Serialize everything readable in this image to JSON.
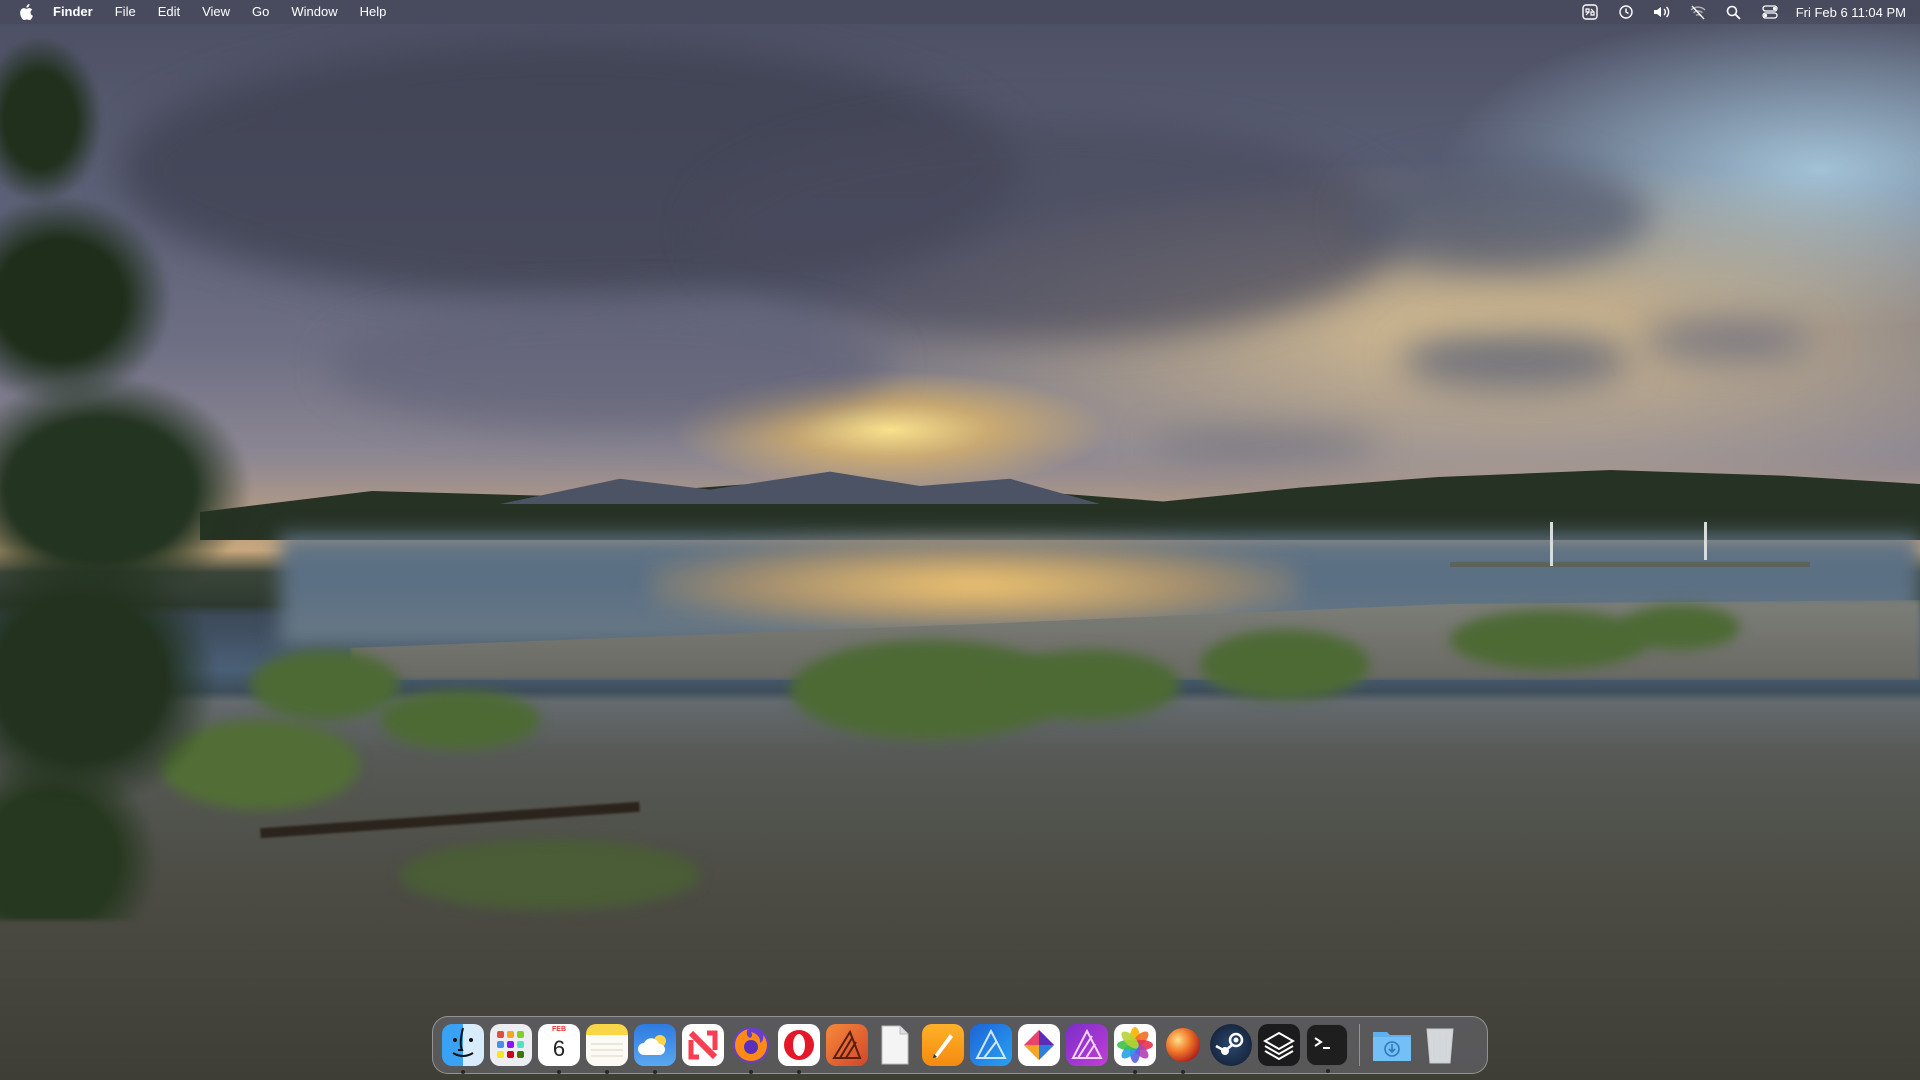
{
  "menubar": {
    "app_name": "Finder",
    "menus": [
      "File",
      "Edit",
      "View",
      "Go",
      "Window",
      "Help"
    ],
    "status_icons": [
      "control-strip-icon",
      "time-machine-icon",
      "volume-icon",
      "wifi-off-icon",
      "spotlight-search-icon",
      "control-center-icon"
    ],
    "clock": "Fri Feb 6  11:04 PM"
  },
  "dock": {
    "apps": [
      {
        "name": "Finder",
        "icon": "finder-icon",
        "running": true
      },
      {
        "name": "Launchpad",
        "icon": "launchpad-icon",
        "running": false
      },
      {
        "name": "Calendar",
        "icon": "calendar-icon",
        "running": true,
        "month": "FEB",
        "day": "6"
      },
      {
        "name": "Notes",
        "icon": "notes-icon",
        "running": true
      },
      {
        "name": "Weather",
        "icon": "weather-icon",
        "running": true
      },
      {
        "name": "News",
        "icon": "news-icon",
        "running": false
      },
      {
        "name": "Firefox",
        "icon": "firefox-icon",
        "running": true
      },
      {
        "name": "Opera",
        "icon": "opera-icon",
        "running": true
      },
      {
        "name": "Affinity",
        "icon": "affinity-icon",
        "running": false
      },
      {
        "name": "TextEdit",
        "icon": "document-icon",
        "running": false
      },
      {
        "name": "Pages",
        "icon": "pages-icon",
        "running": false
      },
      {
        "name": "Affinity Designer",
        "icon": "affinity-designer-icon",
        "running": false
      },
      {
        "name": "Affinity Photo",
        "icon": "affinity-photo-icon",
        "running": false
      },
      {
        "name": "Affinity Publisher",
        "icon": "affinity-publisher-icon",
        "running": false
      },
      {
        "name": "Photos",
        "icon": "photos-icon",
        "running": true
      },
      {
        "name": "Sphere",
        "icon": "sphere-icon",
        "running": true
      },
      {
        "name": "Steam",
        "icon": "steam-icon",
        "running": false
      },
      {
        "name": "Layers",
        "icon": "layers-icon",
        "running": false
      },
      {
        "name": "Terminal",
        "icon": "terminal-icon",
        "running": true
      }
    ],
    "extras": [
      {
        "name": "Downloads",
        "icon": "downloads-folder-icon"
      },
      {
        "name": "Trash",
        "icon": "trash-icon"
      }
    ]
  }
}
